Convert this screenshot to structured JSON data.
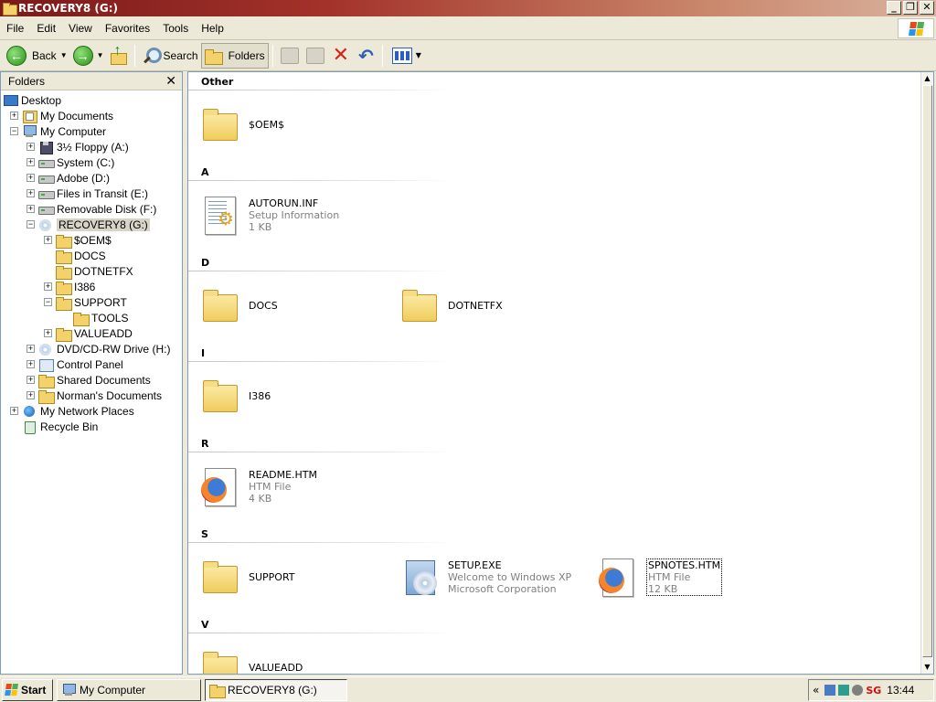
{
  "window": {
    "title": "RECOVERY8 (G:)",
    "minimize": "_",
    "maximize": "❐",
    "close": "✕"
  },
  "menu": [
    "File",
    "Edit",
    "View",
    "Favorites",
    "Tools",
    "Help"
  ],
  "toolbar": {
    "back": "Back",
    "search": "Search",
    "folders": "Folders"
  },
  "folders_pane": {
    "title": "Folders",
    "close": "✕",
    "nodes": [
      {
        "label": "Desktop",
        "icon": "desktop-icon",
        "expander": "",
        "selected": false
      },
      {
        "label": "My Documents",
        "icon": "docs-icon",
        "expander": "+",
        "selected": false
      },
      {
        "label": "My Computer",
        "icon": "computer-icon",
        "expander": "−",
        "selected": false
      },
      {
        "label": "3½ Floppy (A:)",
        "icon": "floppy-icon",
        "expander": "+",
        "selected": false
      },
      {
        "label": "System (C:)",
        "icon": "drive-icon",
        "expander": "+",
        "selected": false
      },
      {
        "label": "Adobe  (D:)",
        "icon": "drive-icon",
        "expander": "+",
        "selected": false
      },
      {
        "label": "Files in Transit (E:)",
        "icon": "drive-icon",
        "expander": "+",
        "selected": false
      },
      {
        "label": "Removable Disk (F:)",
        "icon": "drive-icon",
        "expander": "+",
        "selected": false
      },
      {
        "label": "RECOVERY8 (G:)",
        "icon": "cd-icon",
        "expander": "−",
        "selected": true
      },
      {
        "label": "$OEM$",
        "icon": "folder-icon",
        "expander": "+",
        "selected": false
      },
      {
        "label": "DOCS",
        "icon": "folder-icon",
        "expander": "",
        "selected": false
      },
      {
        "label": "DOTNETFX",
        "icon": "folder-icon",
        "expander": "",
        "selected": false
      },
      {
        "label": "I386",
        "icon": "folder-icon",
        "expander": "+",
        "selected": false
      },
      {
        "label": "SUPPORT",
        "icon": "folder-icon",
        "expander": "−",
        "selected": false
      },
      {
        "label": "TOOLS",
        "icon": "folder-icon",
        "expander": "",
        "selected": false
      },
      {
        "label": "VALUEADD",
        "icon": "folder-icon",
        "expander": "+",
        "selected": false
      },
      {
        "label": "DVD/CD-RW Drive (H:)",
        "icon": "cd-icon",
        "expander": "+",
        "selected": false
      },
      {
        "label": "Control Panel",
        "icon": "panel-icon",
        "expander": "+",
        "selected": false
      },
      {
        "label": "Shared Documents",
        "icon": "folder-icon",
        "expander": "+",
        "selected": false
      },
      {
        "label": "Norman's Documents",
        "icon": "folder-icon",
        "expander": "+",
        "selected": false
      },
      {
        "label": "My Network Places",
        "icon": "network-icon",
        "expander": "+",
        "selected": false
      },
      {
        "label": "Recycle Bin",
        "icon": "recycle-bin-icon",
        "expander": "",
        "selected": false
      }
    ]
  },
  "groups": [
    {
      "letter": "Other",
      "items": [
        {
          "name": "$OEM$",
          "type": "folder",
          "line2": "",
          "line3": ""
        }
      ]
    },
    {
      "letter": "A",
      "items": [
        {
          "name": "AUTORUN.INF",
          "type": "inf",
          "line2": "Setup Information",
          "line3": "1 KB"
        }
      ]
    },
    {
      "letter": "D",
      "items": [
        {
          "name": "DOCS",
          "type": "folder",
          "line2": "",
          "line3": ""
        },
        {
          "name": "DOTNETFX",
          "type": "folder",
          "line2": "",
          "line3": ""
        }
      ]
    },
    {
      "letter": "I",
      "items": [
        {
          "name": "I386",
          "type": "folder",
          "line2": "",
          "line3": ""
        }
      ]
    },
    {
      "letter": "R",
      "items": [
        {
          "name": "README.HTM",
          "type": "htm",
          "line2": "HTM File",
          "line3": "4 KB"
        }
      ]
    },
    {
      "letter": "S",
      "items": [
        {
          "name": "SUPPORT",
          "type": "folder",
          "line2": "",
          "line3": ""
        },
        {
          "name": "SETUP.EXE",
          "type": "setup",
          "line2": "Welcome to Windows XP",
          "line3": "Microsoft Corporation"
        },
        {
          "name": "SPNOTES.HTM",
          "type": "htm",
          "line2": "HTM File",
          "line3": "12 KB"
        }
      ]
    },
    {
      "letter": "V",
      "items": [
        {
          "name": "VALUEADD",
          "type": "folder",
          "line2": "",
          "line3": ""
        }
      ]
    }
  ],
  "taskbar": {
    "start": "Start",
    "tasks": [
      {
        "label": "My Computer",
        "active": false
      },
      {
        "label": "RECOVERY8 (G:)",
        "active": true
      }
    ],
    "tray_chevron": "«",
    "tray_text": "SG",
    "clock": "13:44"
  },
  "colors": {
    "title_start": "#7a1a1a",
    "title_end": "#d9b3a0",
    "chrome": "#ECE9D8",
    "pane_border": "#7f9db9"
  }
}
